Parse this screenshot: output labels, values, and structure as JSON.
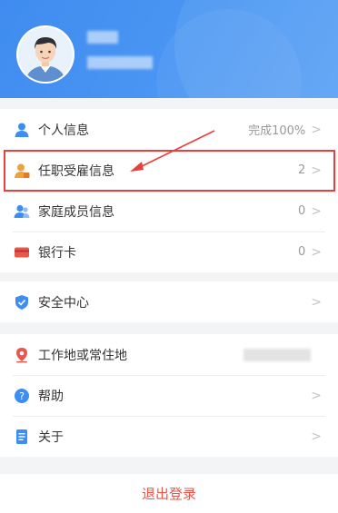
{
  "profile": {
    "avatar_icon": "user-avatar-icon"
  },
  "menu_group1": [
    {
      "label": "个人信息",
      "value": "完成100%",
      "icon": "person-icon",
      "color": "#3d8ef0"
    },
    {
      "label": "任职受雇信息",
      "value": "2",
      "icon": "employee-icon",
      "color": "#f0a23a"
    },
    {
      "label": "家庭成员信息",
      "value": "0",
      "icon": "family-icon",
      "color": "#3d8ef0"
    },
    {
      "label": "银行卡",
      "value": "0",
      "icon": "bank-card-icon",
      "color": "#e9574c"
    }
  ],
  "menu_group2": [
    {
      "label": "安全中心",
      "icon": "shield-icon",
      "color": "#3d8ef0"
    }
  ],
  "menu_group3": [
    {
      "label": "工作地或常住地",
      "icon": "location-icon",
      "color": "#e9574c"
    },
    {
      "label": "帮助",
      "icon": "help-icon",
      "color": "#3d8ef0"
    },
    {
      "label": "关于",
      "icon": "document-icon",
      "color": "#3d8ef0"
    }
  ],
  "chevron": ">",
  "logout_label": "退出登录",
  "colors": {
    "header": "#4a96f3",
    "highlight": "#e8403c",
    "logout": "#e8564c"
  }
}
